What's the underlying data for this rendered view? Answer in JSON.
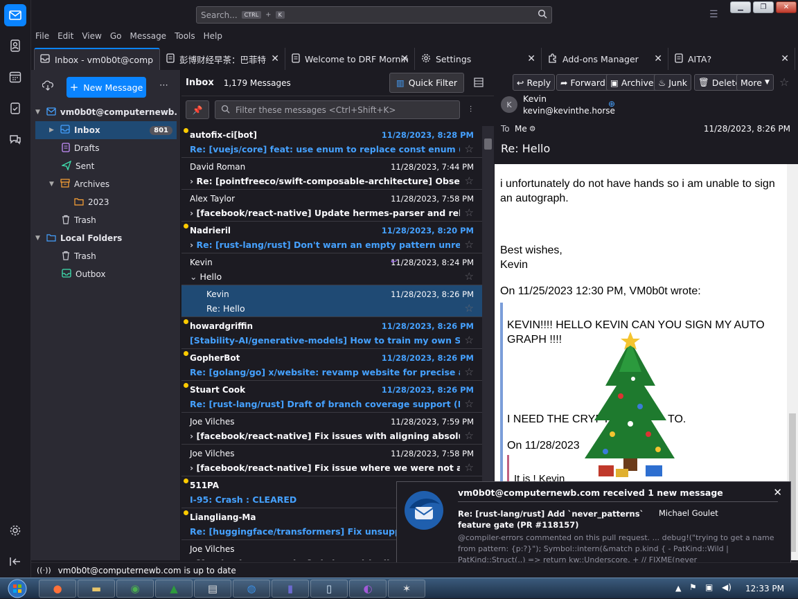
{
  "search": {
    "placeholder": "Search...",
    "kbd1": "CTRL",
    "plus": "+",
    "kbd2": "K"
  },
  "menu": [
    "File",
    "Edit",
    "View",
    "Go",
    "Message",
    "Tools",
    "Help"
  ],
  "tabs": [
    {
      "label": "Inbox - vm0b0t@computernewb.com",
      "icon": "inbox-icon"
    },
    {
      "label": "彭博财经早茶：巴菲特",
      "icon": "document-icon"
    },
    {
      "label": "Welcome to DRF Morning",
      "icon": "document-icon"
    },
    {
      "label": "Settings",
      "icon": "gear-icon"
    },
    {
      "label": "Add-ons Manager",
      "icon": "puzzle-icon"
    },
    {
      "label": "AITA?",
      "icon": "document-icon"
    }
  ],
  "folders": {
    "new_message": "New Message",
    "account": "vm0b0t@computernewb.com",
    "items": [
      {
        "label": "Inbox",
        "badge": "801"
      },
      {
        "label": "Drafts"
      },
      {
        "label": "Sent"
      },
      {
        "label": "Archives"
      },
      {
        "label": "2023"
      },
      {
        "label": "Trash"
      },
      {
        "label": "Local Folders"
      },
      {
        "label": "Trash"
      },
      {
        "label": "Outbox"
      }
    ]
  },
  "list": {
    "title": "Inbox",
    "count": "1,179 Messages",
    "quick_filter": "Quick Filter",
    "filter_placeholder": "Filter these messages <Ctrl+Shift+K>",
    "messages": [
      {
        "sender": "autofix-ci[bot]",
        "date": "11/28/2023, 8:28 PM",
        "subject": "Re: [vuejs/core] feat: use enum to replace const enum (PR #…",
        "unread": true
      },
      {
        "sender": "David Roman",
        "date": "11/28/2023, 7:44 PM",
        "subject": "Re: [pointfreeco/swift-composable-architecture] Observatio…",
        "thread": true
      },
      {
        "sender": "Alex Taylor",
        "date": "11/28/2023, 7:58 PM",
        "subject": "[facebook/react-native] Update hermes-parser and related…",
        "thread": true
      },
      {
        "sender": "Nadrieril",
        "date": "11/28/2023, 8:20 PM",
        "subject": "Re: [rust-lang/rust] Don't warn an empty pattern unreach…",
        "unread": true,
        "thread": true
      },
      {
        "sender": "Kevin",
        "date": "11/28/2023, 8:24 PM",
        "subject": "Hello",
        "open": true
      },
      {
        "sender": "Kevin",
        "date": "11/28/2023, 8:26 PM",
        "subject": "Re: Hello",
        "selected": true
      },
      {
        "sender": "howardgriffin",
        "date": "11/28/2023, 8:26 PM",
        "subject": "[Stability-AI/generative-models] How to train my own SDXL…",
        "unread": true
      },
      {
        "sender": "GopherBot",
        "date": "11/28/2023, 8:26 PM",
        "subject": "Re: [golang/go] x/website: revamp website for precise and p…",
        "unread": true
      },
      {
        "sender": "Stuart Cook",
        "date": "11/28/2023, 8:26 PM",
        "subject": "Re: [rust-lang/rust] Draft of branch coverage support (PR #1…",
        "unread": true
      },
      {
        "sender": "Joe Vilches",
        "date": "11/28/2023, 7:59 PM",
        "subject": "[facebook/react-native] Fix issues with aligning absolute …",
        "thread": true
      },
      {
        "sender": "Joe Vilches",
        "date": "11/28/2023, 7:58 PM",
        "subject": "[facebook/react-native] Fix issue where we were not apply…",
        "thread": true
      },
      {
        "sender": "511PA",
        "date": "",
        "subject": "I-95: Crash : CLEARED",
        "unread": true
      },
      {
        "sender": "Liangliang-Ma",
        "date": "",
        "subject": "Re: [huggingface/transformers] Fix unsupported",
        "unread": true
      },
      {
        "sender": "Joe Vilches",
        "date": "",
        "subject": "[facebook/react-native] Fix bug with align-sta…",
        "thread": true
      }
    ]
  },
  "reader": {
    "buttons": [
      "Reply",
      "Forward",
      "Archive",
      "Junk",
      "Delete",
      "More"
    ],
    "from_name": "Kevin",
    "from_email": "kevin@kevinthe.horse",
    "avatar": "K",
    "to_label": "To",
    "to": "Me",
    "date": "11/28/2023, 8:26 PM",
    "subject": "Re: Hello",
    "body": {
      "p1": "i unfortunately do not have hands so i am unable to sign an autograph.",
      "p2": "Best wishes,",
      "p3": "Kevin",
      "quote_header": "On 11/25/2023 12:30 PM, VM0b0t wrote:",
      "q1": "KEVIN!!!! HELLO KEVIN CAN YOU SIGN MY AUTO GRAPH !!!!",
      "q2": "I NEED THE CRYPTO",
      "q2b": "TO.",
      "q3": "On 11/28/2023",
      "q4": "It is !  Kevin"
    }
  },
  "notification": {
    "title": "vm0b0t@computernewb.com received 1 new message",
    "subject": "Re: [rust-lang/rust] Add `never_patterns` feature gate (PR #118157)",
    "sender": "Michael Goulet",
    "preview": "@compiler-errors commented on this pull request. ... debug!(\"trying to get a name from pattern: {p:?}\"); Symbol::intern(&match p.kind { - PatKind::Wild | PatKind::Struct(..) => return kw::Underscore, + // FIXME(never"
  },
  "status": "vm0b0t@computernewb.com is up to date",
  "clock": "12:33 PM"
}
